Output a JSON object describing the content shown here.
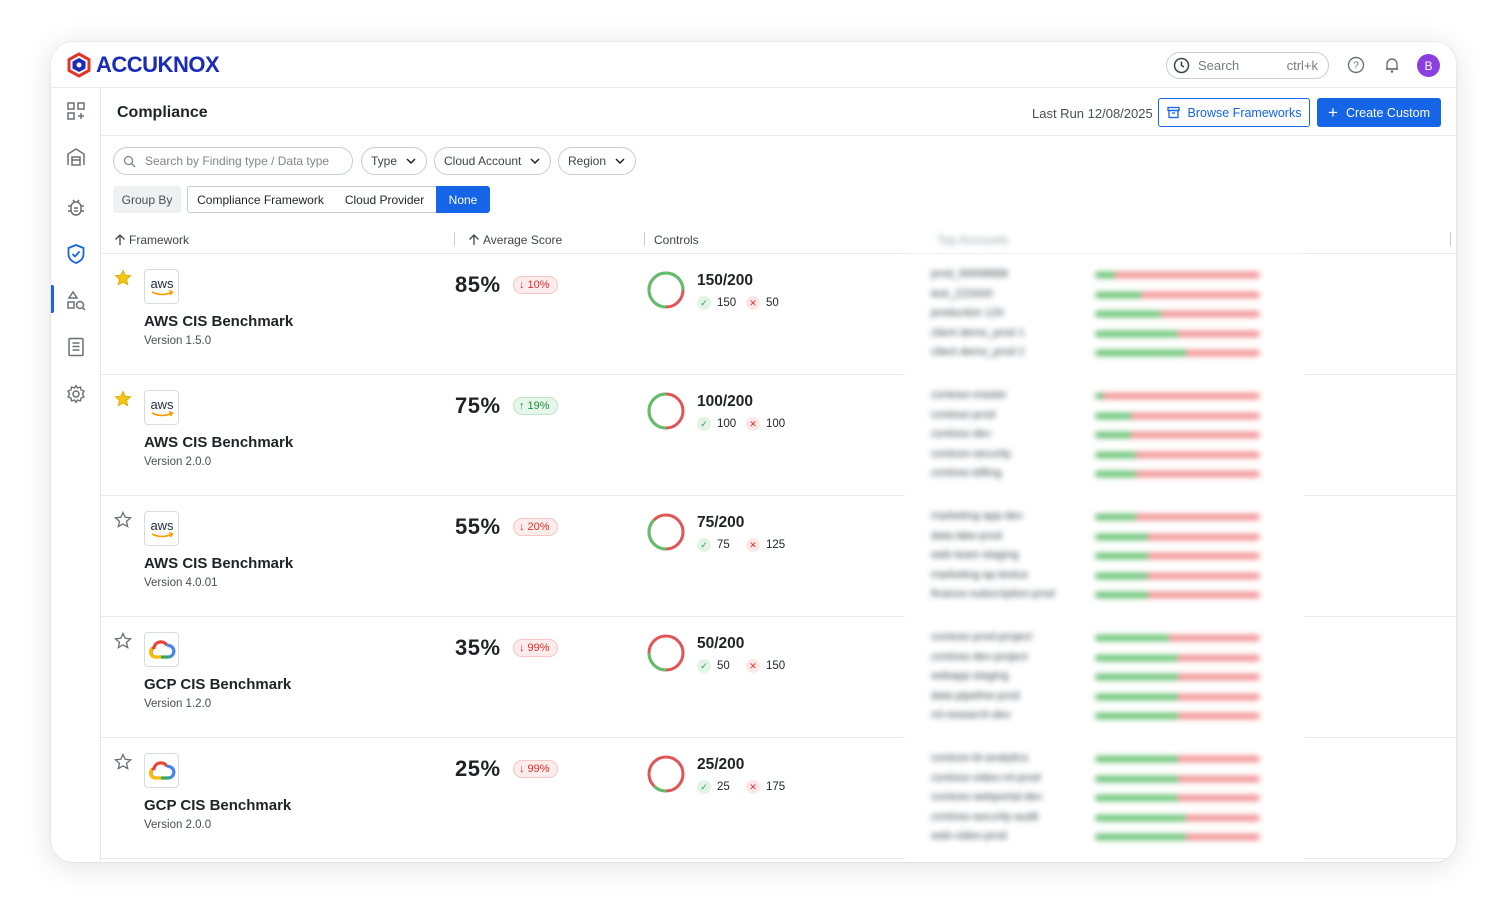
{
  "app": {
    "logo_text": "ACCUKNOX"
  },
  "topbar": {
    "search_placeholder": "Search",
    "search_shortcut": "ctrl+k",
    "avatar_initial": "B"
  },
  "page": {
    "title": "Compliance",
    "last_run": "Last Run 12/08/2025",
    "browse_label": "Browse Frameworks",
    "create_label": "Create Custom"
  },
  "filters": {
    "search_placeholder": "Search by Finding type / Data type",
    "type_label": "Type",
    "cloud_account_label": "Cloud Account",
    "region_label": "Region",
    "group_by_label": "Group By",
    "group_options": [
      "Compliance Framework",
      "Cloud Provider",
      "None"
    ],
    "group_selected": "None"
  },
  "table": {
    "col_framework": "Framework",
    "col_score": "Average Score",
    "col_controls": "Controls",
    "col_accounts": "Top Accounts",
    "rows": [
      {
        "starred": true,
        "provider": "aws",
        "name": "AWS CIS Benchmark",
        "version": "Version 1.5.0",
        "score": "85%",
        "delta": "10%",
        "delta_dir": "down",
        "controls": "150/200",
        "passed": "150",
        "failed": "50",
        "pass_fraction": 0.75,
        "accounts": [
          "prod_99998888",
          "test_ZZ0000",
          "production 120",
          "client demo_prod 1",
          "client demo_prod 2"
        ],
        "account_pass": [
          0.12,
          0.28,
          0.4,
          0.5,
          0.55
        ]
      },
      {
        "starred": true,
        "provider": "aws",
        "name": "AWS CIS Benchmark",
        "version": "Version 2.0.0",
        "score": "75%",
        "delta": "19%",
        "delta_dir": "up",
        "controls": "100/200",
        "passed": "100",
        "failed": "100",
        "pass_fraction": 0.5,
        "accounts": [
          "contoso-master",
          "contoso-prod",
          "contoso-dev",
          "contoso-security",
          "contoso-billing"
        ],
        "account_pass": [
          0.05,
          0.22,
          0.22,
          0.25,
          0.25
        ]
      },
      {
        "starred": false,
        "provider": "aws",
        "name": "AWS CIS Benchmark",
        "version": "Version 4.0.01",
        "score": "55%",
        "delta": "20%",
        "delta_dir": "down",
        "controls": "75/200",
        "passed": "75",
        "failed": "125",
        "pass_fraction": 0.375,
        "accounts": [
          "marketing-app-dev",
          "data-lake-prod",
          "web-team-staging",
          "marketing-ap-testus",
          "finance-subscription-prod"
        ],
        "account_pass": [
          0.25,
          0.32,
          0.32,
          0.32,
          0.32
        ]
      },
      {
        "starred": false,
        "provider": "gcp",
        "name": "GCP CIS Benchmark",
        "version": "Version 1.2.0",
        "score": "35%",
        "delta": "99%",
        "delta_dir": "down",
        "controls": "50/200",
        "passed": "50",
        "failed": "150",
        "pass_fraction": 0.25,
        "accounts": [
          "contoso-prod-project",
          "contoso-dev-project",
          "webapp-staging",
          "data-pipeline-prod",
          "ml-research-dev"
        ],
        "account_pass": [
          0.45,
          0.5,
          0.5,
          0.5,
          0.5
        ]
      },
      {
        "starred": false,
        "provider": "gcp",
        "name": "GCP CIS Benchmark",
        "version": "Version 2.0.0",
        "score": "25%",
        "delta": "99%",
        "delta_dir": "down",
        "controls": "25/200",
        "passed": "25",
        "failed": "175",
        "pass_fraction": 0.125,
        "accounts": [
          "contoso-bi-analytics",
          "contoso-video-ml-prod",
          "contoso-webportal-dev",
          "contoso-security-audit",
          "web-video-prod"
        ],
        "account_pass": [
          0.5,
          0.5,
          0.5,
          0.55,
          0.55
        ]
      }
    ]
  },
  "colors": {
    "accent": "#1565e6",
    "pass": "#5fbf6c",
    "fail": "#e05555",
    "star": "#f5c518"
  }
}
